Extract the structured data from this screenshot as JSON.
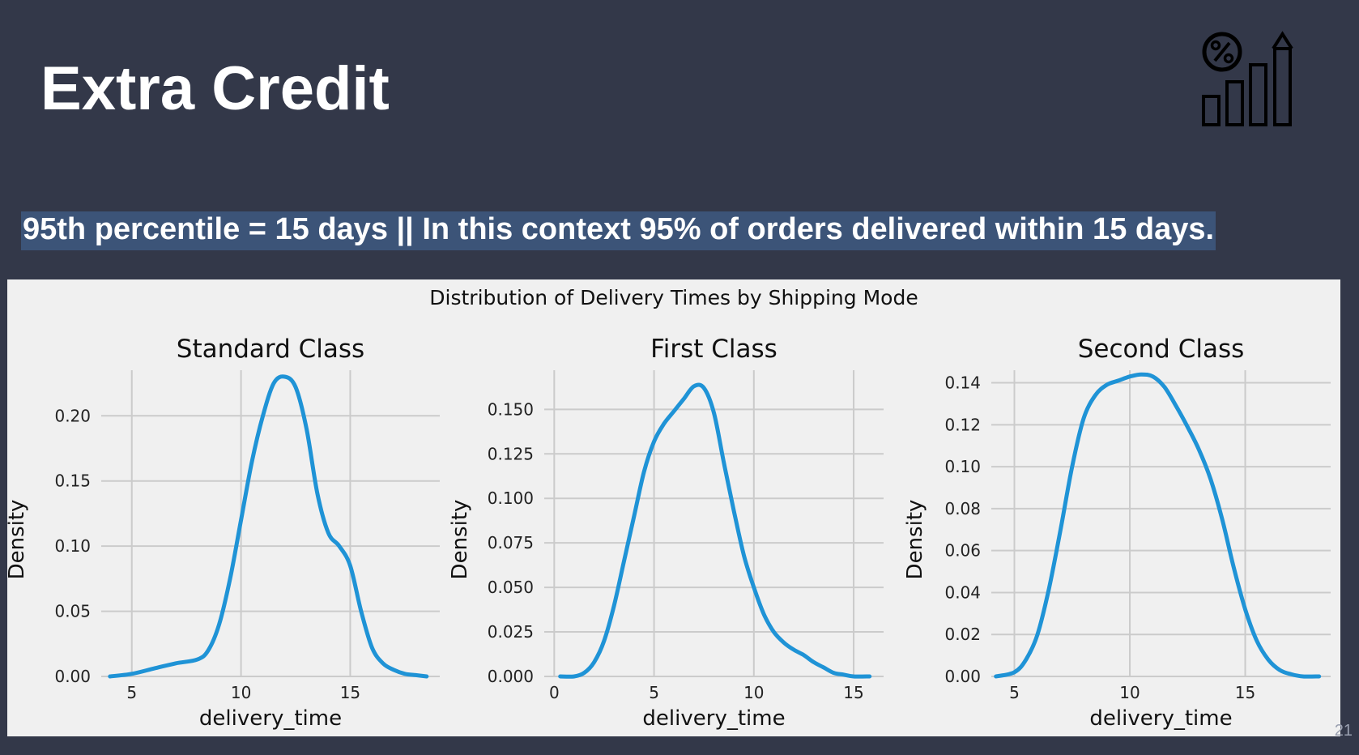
{
  "slide": {
    "title": "Extra Credit",
    "headline": "95th percentile = 15 days || In this context 95% of orders delivered within 15 days.",
    "page_number": "21",
    "icon": "percent-growth-chart-icon",
    "colors": {
      "background": "#333849",
      "highlight": "#3c5478",
      "line": "#1f93d6",
      "panel": "#f0f0f0"
    }
  },
  "chart_data": {
    "title": "Distribution of Delivery Times by Shipping Mode",
    "panels": [
      {
        "type": "line",
        "title": "Standard Class",
        "xlabel": "delivery_time",
        "ylabel": "Density",
        "xlim": [
          3.6,
          19.1
        ],
        "ylim": [
          0,
          0.235
        ],
        "xticks": [
          5,
          10,
          15
        ],
        "yticks": [
          0.0,
          0.05,
          0.1,
          0.15,
          0.2
        ],
        "ytick_labels": [
          "0.00",
          "0.05",
          "0.10",
          "0.15",
          "0.20"
        ],
        "x": [
          4.0,
          5.0,
          6.0,
          7.0,
          8.0,
          8.5,
          9.0,
          9.5,
          10.0,
          10.5,
          11.0,
          11.5,
          12.0,
          12.5,
          13.0,
          13.5,
          14.0,
          14.5,
          15.0,
          15.5,
          16.0,
          16.5,
          17.0,
          17.5,
          18.0,
          18.5
        ],
        "y": [
          0.0,
          0.002,
          0.006,
          0.01,
          0.013,
          0.02,
          0.04,
          0.075,
          0.12,
          0.165,
          0.2,
          0.225,
          0.23,
          0.222,
          0.19,
          0.14,
          0.11,
          0.1,
          0.085,
          0.05,
          0.022,
          0.01,
          0.005,
          0.002,
          0.001,
          0.0
        ]
      },
      {
        "type": "line",
        "title": "First Class",
        "xlabel": "delivery_time",
        "ylabel": "Density",
        "xlim": [
          -0.5,
          16.5
        ],
        "ylim": [
          0,
          0.172
        ],
        "xticks": [
          0,
          5,
          10,
          15
        ],
        "yticks": [
          0.0,
          0.025,
          0.05,
          0.075,
          0.1,
          0.125,
          0.15
        ],
        "ytick_labels": [
          "0.000",
          "0.025",
          "0.050",
          "0.075",
          "0.100",
          "0.125",
          "0.150"
        ],
        "x": [
          0.3,
          1.0,
          1.5,
          2.0,
          2.5,
          3.0,
          3.5,
          4.0,
          4.5,
          5.0,
          5.5,
          6.0,
          6.5,
          7.0,
          7.5,
          8.0,
          8.5,
          9.0,
          9.5,
          10.0,
          10.5,
          11.0,
          11.5,
          12.0,
          12.5,
          13.0,
          13.5,
          14.0,
          14.5,
          15.0,
          15.8
        ],
        "y": [
          0.0,
          0.0,
          0.002,
          0.008,
          0.02,
          0.04,
          0.065,
          0.09,
          0.115,
          0.132,
          0.142,
          0.149,
          0.156,
          0.163,
          0.162,
          0.148,
          0.12,
          0.093,
          0.068,
          0.05,
          0.035,
          0.025,
          0.019,
          0.015,
          0.012,
          0.008,
          0.005,
          0.002,
          0.001,
          0.0,
          0.0
        ]
      },
      {
        "type": "line",
        "title": "Second Class",
        "xlabel": "delivery_time",
        "ylabel": "Density",
        "xlim": [
          4.0,
          18.7
        ],
        "ylim": [
          0,
          0.146
        ],
        "xticks": [
          5,
          10,
          15
        ],
        "yticks": [
          0.0,
          0.02,
          0.04,
          0.06,
          0.08,
          0.1,
          0.12,
          0.14
        ],
        "ytick_labels": [
          "0.00",
          "0.02",
          "0.04",
          "0.06",
          "0.08",
          "0.10",
          "0.12",
          "0.14"
        ],
        "x": [
          4.2,
          5.0,
          5.5,
          6.0,
          6.5,
          7.0,
          7.5,
          8.0,
          8.5,
          9.0,
          9.5,
          10.0,
          10.5,
          11.0,
          11.5,
          12.0,
          12.5,
          13.0,
          13.5,
          14.0,
          14.5,
          15.0,
          15.5,
          16.0,
          16.5,
          17.0,
          17.5,
          18.2
        ],
        "y": [
          0.0,
          0.002,
          0.008,
          0.02,
          0.042,
          0.07,
          0.1,
          0.123,
          0.134,
          0.139,
          0.141,
          0.143,
          0.144,
          0.143,
          0.138,
          0.129,
          0.119,
          0.108,
          0.094,
          0.075,
          0.052,
          0.032,
          0.017,
          0.008,
          0.003,
          0.001,
          0.0,
          0.0
        ]
      }
    ]
  }
}
